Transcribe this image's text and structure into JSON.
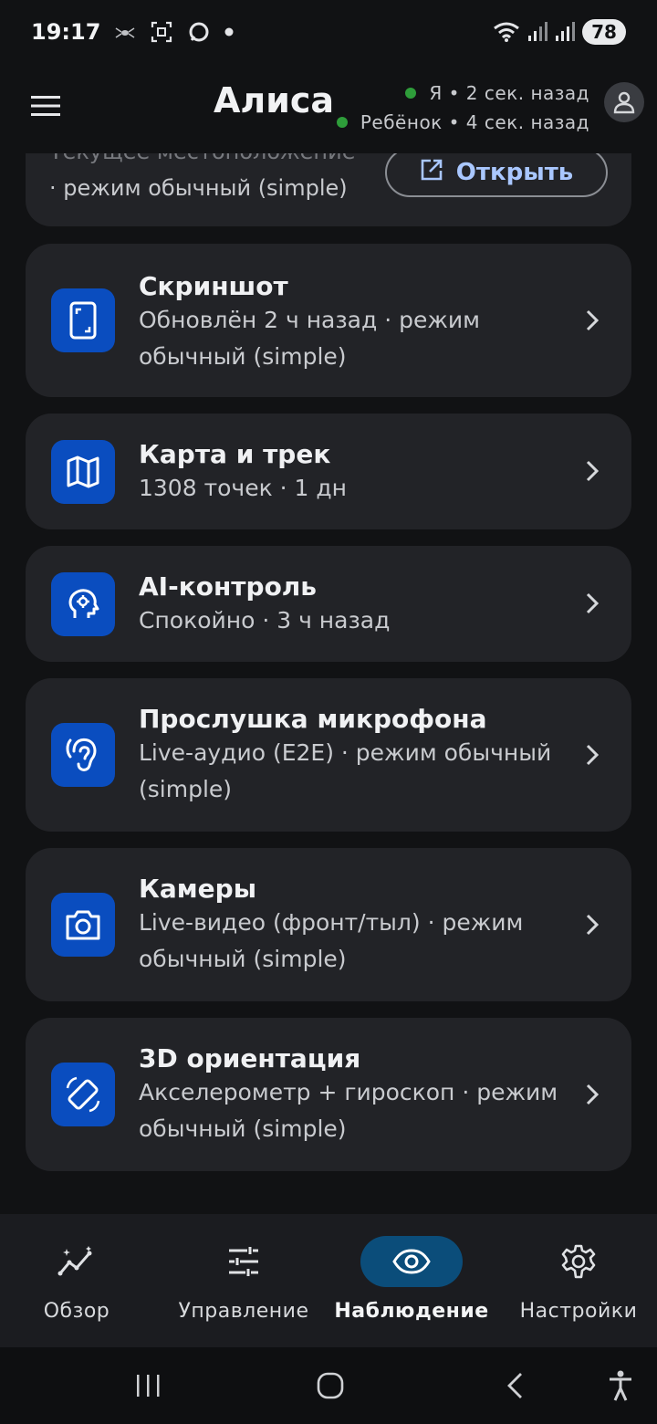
{
  "status_bar": {
    "time": "19:17",
    "battery": "78"
  },
  "app_bar": {
    "title": "Алиса",
    "presence": [
      {
        "label": "Я • 2 сек. назад",
        "color": "#2e9d3a"
      },
      {
        "label": "Ребёнок • 4 сек. назад",
        "color": "#2e9d3a"
      }
    ]
  },
  "partial_card": {
    "line1": "Текущее местоположение",
    "line2": "· режим обычный (simple)",
    "open_label": "Открыть"
  },
  "items": [
    {
      "title": "Скриншот",
      "subtitle": "Обновлён 2 ч назад · режим обычный (simple)",
      "icon": "phone-screenshot-icon"
    },
    {
      "title": "Карта и трек",
      "subtitle": "1308 точек · 1 дн",
      "icon": "map-icon"
    },
    {
      "title": "AI-контроль",
      "subtitle": "Спокойно · 3 ч назад",
      "icon": "ai-brain-icon"
    },
    {
      "title": "Прослушка микрофона",
      "subtitle": "Live-аудио (E2E) · режим обычный (simple)",
      "icon": "hearing-icon"
    },
    {
      "title": "Камеры",
      "subtitle": "Live-видео (фронт/тыл) · режим обычный (simple)",
      "icon": "camera-icon"
    },
    {
      "title": "3D ориентация",
      "subtitle": "Акселерометр + гироскоп · режим обычный (simple)",
      "icon": "screen-rotation-icon"
    }
  ],
  "bottom_nav": [
    {
      "label": "Обзор",
      "icon": "analytics-icon",
      "active": false
    },
    {
      "label": "Управление",
      "icon": "sliders-icon",
      "active": false
    },
    {
      "label": "Наблюдение",
      "icon": "eye-icon",
      "active": true
    },
    {
      "label": "Настройки",
      "icon": "gear-icon",
      "active": false
    }
  ],
  "colors": {
    "background": "#111214",
    "card": "#222327",
    "accent_icon_bg": "#0a4dbf",
    "open_button_text": "#a9c7ff",
    "active_nav_pill": "#0b4d7a",
    "online_dot": "#2e9d3a"
  }
}
